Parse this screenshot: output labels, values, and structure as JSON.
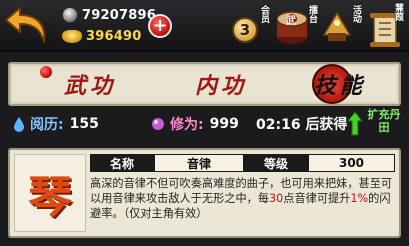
{
  "resources": {
    "silver": "79207896",
    "gold": "396490"
  },
  "top_icons": {
    "vip": {
      "label": "会员",
      "level": "3"
    },
    "martial": {
      "label": "武",
      "tag": "擂台"
    },
    "event": {
      "label": "活动"
    },
    "scroll": {
      "label": "蒹葭"
    }
  },
  "tabs": [
    {
      "label": "武功"
    },
    {
      "label": "内功"
    },
    {
      "label": "技能"
    }
  ],
  "stats": {
    "yueli_label": "阅历:",
    "yueli_value": "155",
    "xiuwei_label": "修为:",
    "xiuwei_value": "999",
    "timer": "02:16 后获得",
    "expand_label": "扩充丹田"
  },
  "skill": {
    "char": "琴",
    "name_label": "名称",
    "name_value": "音律",
    "level_label": "等级",
    "level_value": "300",
    "desc_part1": "高深的音律不但可吹奏高难度的曲子，也可用来把妹，甚至可以用音律来攻击敌人于无形之中，每",
    "desc_hl1": "30",
    "desc_part2": "点音律可提升",
    "desc_hl2": "1%",
    "desc_part3": "的闪避率。（仅对主角有效）"
  },
  "colors": {
    "accent_red": "#a71410",
    "gold_text": "#ffd84a",
    "panel_bg": "#ece6d4",
    "expand_green": "#7ef06a"
  }
}
